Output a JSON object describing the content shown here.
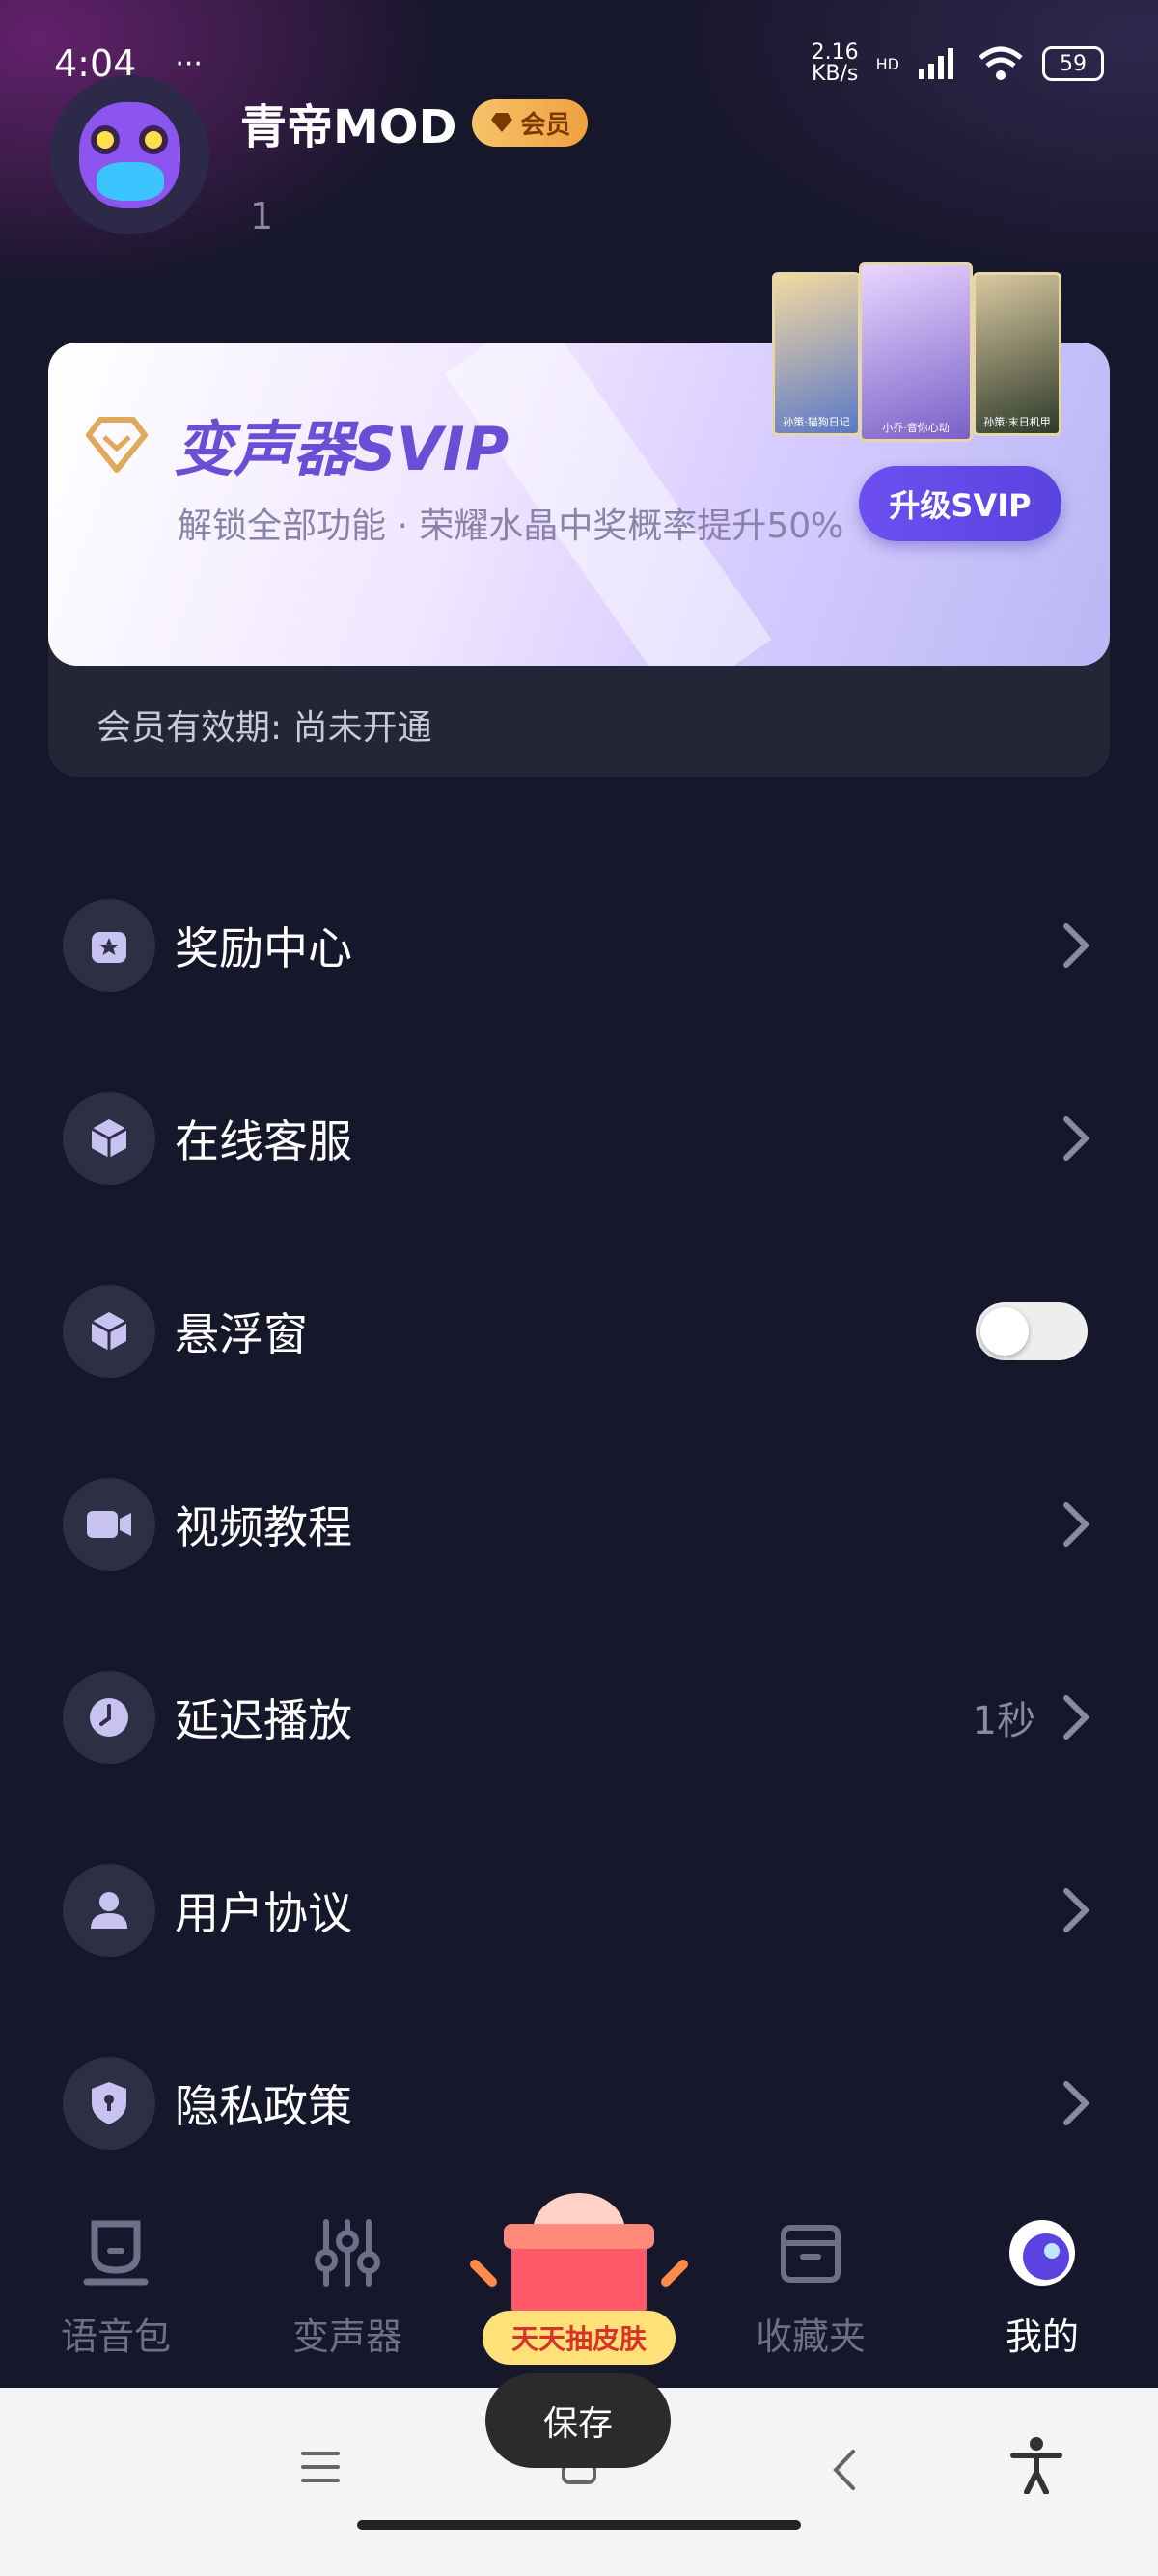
{
  "status_bar": {
    "time": "4:04",
    "dots": "···",
    "speed": "2.16",
    "speed_unit": "KB/s",
    "hd": "HD",
    "battery": "59"
  },
  "profile": {
    "name": "青帝MOD",
    "badge": "会员",
    "id": "1"
  },
  "svip": {
    "title": "变声器SVIP",
    "description": "解锁全部功能 · 荣耀水晶中奖概率提升50%",
    "upgrade_label": "升级SVIP",
    "expiry": "会员有效期: 尚未开通",
    "skins": [
      "孙策·猫狗日记",
      "小乔·音你心动",
      "孙策·末日机甲"
    ]
  },
  "menu": {
    "items": [
      {
        "label": "奖励中心",
        "icon": "gift-star-icon"
      },
      {
        "label": "在线客服",
        "icon": "cube-icon"
      },
      {
        "label": "悬浮窗",
        "icon": "cube-icon",
        "toggle": false
      },
      {
        "label": "视频教程",
        "icon": "video-camera-icon"
      },
      {
        "label": "延迟播放",
        "icon": "clock-icon",
        "value": "1秒"
      },
      {
        "label": "用户协议",
        "icon": "user-icon"
      },
      {
        "label": "隐私政策",
        "icon": "shield-icon"
      }
    ]
  },
  "tabs": {
    "voice_pack": "语音包",
    "voice_changer": "变声器",
    "promo": "天天抽皮肤",
    "favorites": "收藏夹",
    "mine": "我的"
  },
  "toast": "保存",
  "colors": {
    "accent": "#6d4ff0",
    "background": "#17172b",
    "badge_gold": "#f6c36a"
  }
}
